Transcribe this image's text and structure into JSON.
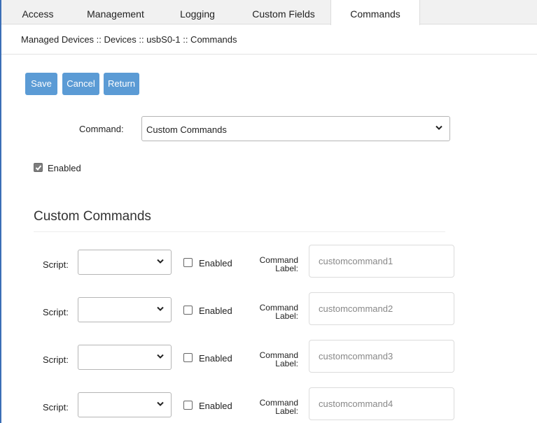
{
  "tabs": [
    {
      "label": "Access"
    },
    {
      "label": "Management"
    },
    {
      "label": "Logging"
    },
    {
      "label": "Custom Fields"
    },
    {
      "label": "Commands",
      "active": true
    }
  ],
  "breadcrumb": "Managed Devices :: Devices :: usbS0-1 :: Commands",
  "buttons": {
    "save": "Save",
    "cancel": "Cancel",
    "return": "Return"
  },
  "command": {
    "label": "Command:",
    "value": "Custom Commands"
  },
  "enabled": {
    "label": "Enabled",
    "checked": true
  },
  "section": {
    "title": "Custom Commands"
  },
  "rows": [
    {
      "script_label": "Script:",
      "script_value": "",
      "enabled_label": "Enabled",
      "enabled": false,
      "cmd_label_1": "Command",
      "cmd_label_2": "Label:",
      "placeholder": "customcommand1"
    },
    {
      "script_label": "Script:",
      "script_value": "",
      "enabled_label": "Enabled",
      "enabled": false,
      "cmd_label_1": "Command",
      "cmd_label_2": "Label:",
      "placeholder": "customcommand2"
    },
    {
      "script_label": "Script:",
      "script_value": "",
      "enabled_label": "Enabled",
      "enabled": false,
      "cmd_label_1": "Command",
      "cmd_label_2": "Label:",
      "placeholder": "customcommand3"
    },
    {
      "script_label": "Script:",
      "script_value": "",
      "enabled_label": "Enabled",
      "enabled": false,
      "cmd_label_1": "Command",
      "cmd_label_2": "Label:",
      "placeholder": "customcommand4"
    }
  ],
  "colors": {
    "button": "#5b9bd5",
    "edge": "#3b6fb6"
  }
}
